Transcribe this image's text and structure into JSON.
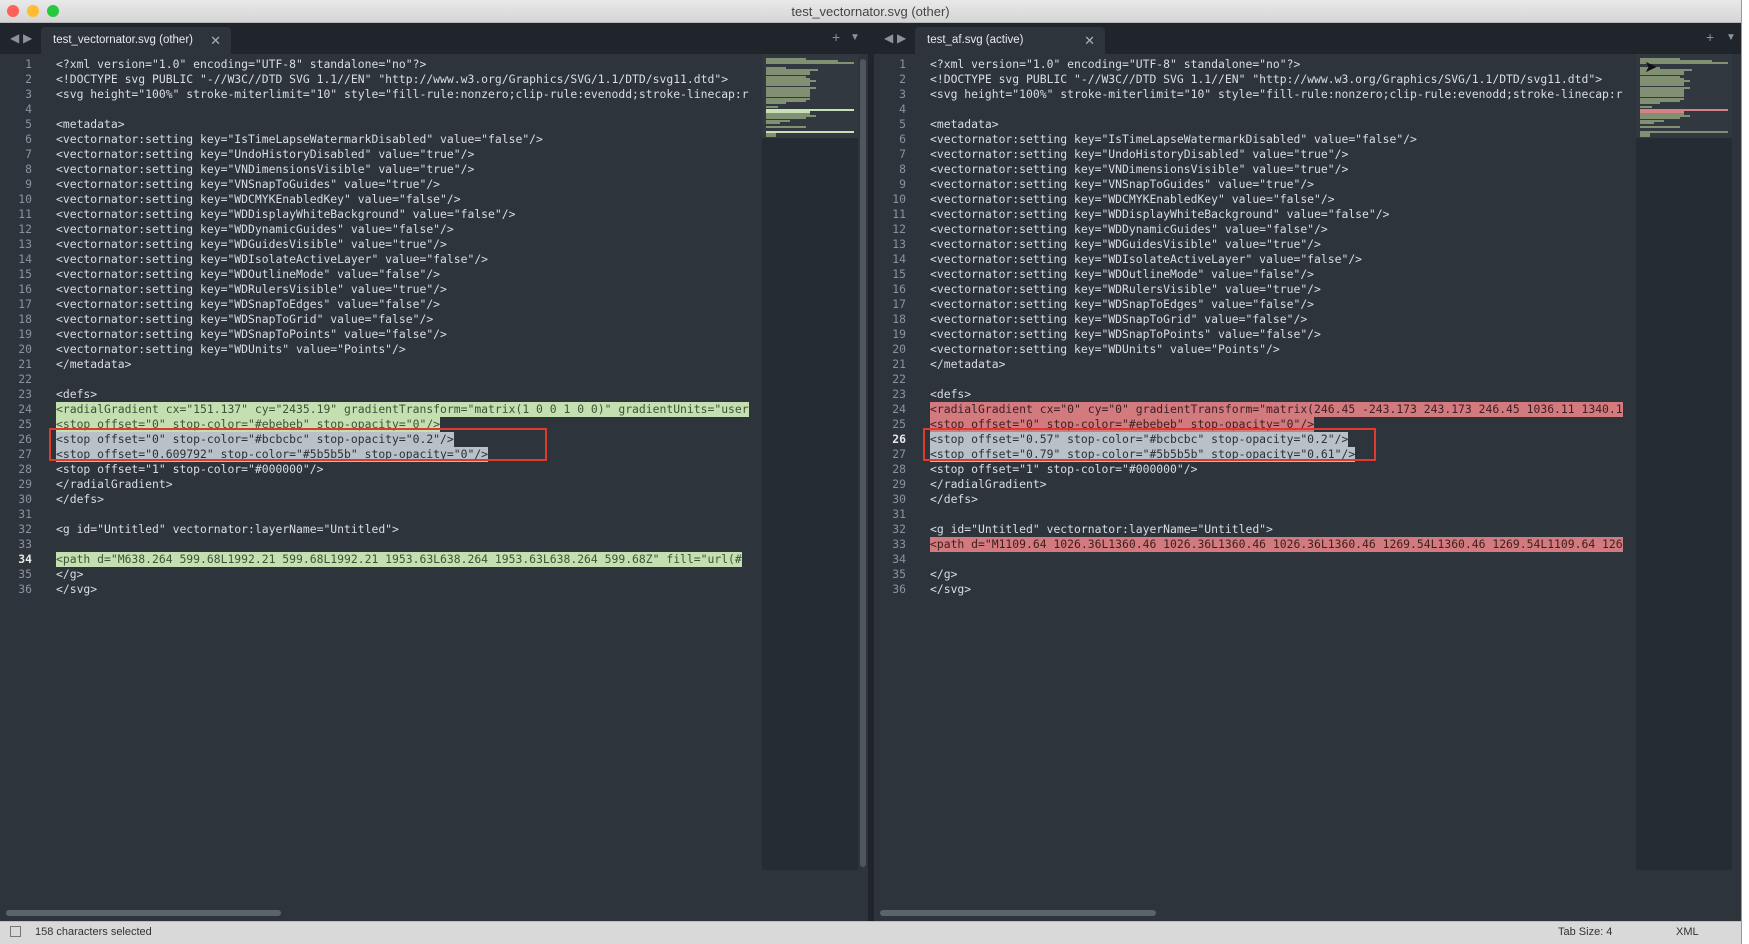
{
  "window": {
    "title": "test_vectornator.svg (other)"
  },
  "left_pane": {
    "tab_label": "test_vectornator.svg (other)",
    "lines": [
      "<?xml version=\"1.0\" encoding=\"UTF-8\" standalone=\"no\"?>",
      "<!DOCTYPE svg PUBLIC \"-//W3C//DTD SVG 1.1//EN\" \"http://www.w3.org/Graphics/SVG/1.1/DTD/svg11.dtd\">",
      "<svg height=\"100%\" stroke-miterlimit=\"10\" style=\"fill-rule:nonzero;clip-rule:evenodd;stroke-linecap:r",
      "",
      "<metadata>",
      "<vectornator:setting key=\"IsTimeLapseWatermarkDisabled\" value=\"false\"/>",
      "<vectornator:setting key=\"UndoHistoryDisabled\" value=\"true\"/>",
      "<vectornator:setting key=\"VNDimensionsVisible\" value=\"true\"/>",
      "<vectornator:setting key=\"VNSnapToGuides\" value=\"true\"/>",
      "<vectornator:setting key=\"WDCMYKEnabledKey\" value=\"false\"/>",
      "<vectornator:setting key=\"WDDisplayWhiteBackground\" value=\"false\"/>",
      "<vectornator:setting key=\"WDDynamicGuides\" value=\"false\"/>",
      "<vectornator:setting key=\"WDGuidesVisible\" value=\"true\"/>",
      "<vectornator:setting key=\"WDIsolateActiveLayer\" value=\"false\"/>",
      "<vectornator:setting key=\"WDOutlineMode\" value=\"false\"/>",
      "<vectornator:setting key=\"WDRulersVisible\" value=\"true\"/>",
      "<vectornator:setting key=\"WDSnapToEdges\" value=\"false\"/>",
      "<vectornator:setting key=\"WDSnapToGrid\" value=\"false\"/>",
      "<vectornator:setting key=\"WDSnapToPoints\" value=\"false\"/>",
      "<vectornator:setting key=\"WDUnits\" value=\"Points\"/>",
      "</metadata>",
      "",
      "<defs>",
      "<radialGradient cx=\"151.137\" cy=\"2435.19\" gradientTransform=\"matrix(1 0 0 1 0 0)\" gradientUnits=\"user",
      "<stop offset=\"0\" stop-color=\"#ebebeb\" stop-opacity=\"0\"/>",
      "<stop offset=\"0\" stop-color=\"#bcbcbc\" stop-opacity=\"0.2\"/>",
      "<stop offset=\"0.609792\" stop-color=\"#5b5b5b\" stop-opacity=\"0\"/>",
      "<stop offset=\"1\" stop-color=\"#000000\"/>",
      "</radialGradient>",
      "</defs>",
      "",
      "<g id=\"Untitled\" vectornator:layerName=\"Untitled\">",
      "",
      "<path d=\"M638.264 599.68L1992.21 599.68L1992.21 1953.63L638.264 1953.63L638.264 599.68Z\" fill=\"url(#",
      "</g>",
      "</svg>"
    ]
  },
  "right_pane": {
    "tab_label": "test_af.svg (active)",
    "lines": [
      "<?xml version=\"1.0\" encoding=\"UTF-8\" standalone=\"no\"?>",
      "<!DOCTYPE svg PUBLIC \"-//W3C//DTD SVG 1.1//EN\" \"http://www.w3.org/Graphics/SVG/1.1/DTD/svg11.dtd\">",
      "<svg height=\"100%\" stroke-miterlimit=\"10\" style=\"fill-rule:nonzero;clip-rule:evenodd;stroke-linecap:r",
      "",
      "<metadata>",
      "<vectornator:setting key=\"IsTimeLapseWatermarkDisabled\" value=\"false\"/>",
      "<vectornator:setting key=\"UndoHistoryDisabled\" value=\"true\"/>",
      "<vectornator:setting key=\"VNDimensionsVisible\" value=\"true\"/>",
      "<vectornator:setting key=\"VNSnapToGuides\" value=\"true\"/>",
      "<vectornator:setting key=\"WDCMYKEnabledKey\" value=\"false\"/>",
      "<vectornator:setting key=\"WDDisplayWhiteBackground\" value=\"false\"/>",
      "<vectornator:setting key=\"WDDynamicGuides\" value=\"false\"/>",
      "<vectornator:setting key=\"WDGuidesVisible\" value=\"true\"/>",
      "<vectornator:setting key=\"WDIsolateActiveLayer\" value=\"false\"/>",
      "<vectornator:setting key=\"WDOutlineMode\" value=\"false\"/>",
      "<vectornator:setting key=\"WDRulersVisible\" value=\"true\"/>",
      "<vectornator:setting key=\"WDSnapToEdges\" value=\"false\"/>",
      "<vectornator:setting key=\"WDSnapToGrid\" value=\"false\"/>",
      "<vectornator:setting key=\"WDSnapToPoints\" value=\"false\"/>",
      "<vectornator:setting key=\"WDUnits\" value=\"Points\"/>",
      "</metadata>",
      "",
      "<defs>",
      "<radialGradient cx=\"0\" cy=\"0\" gradientTransform=\"matrix(246.45 -243.173 243.173 246.45 1036.11 1340.1",
      "<stop offset=\"0\" stop-color=\"#ebebeb\" stop-opacity=\"0\"/>",
      "<stop offset=\"0.57\" stop-color=\"#bcbcbc\" stop-opacity=\"0.2\"/>",
      "<stop offset=\"0.79\" stop-color=\"#5b5b5b\" stop-opacity=\"0.61\"/>",
      "<stop offset=\"1\" stop-color=\"#000000\"/>",
      "</radialGradient>",
      "</defs>",
      "",
      "<g id=\"Untitled\" vectornator:layerName=\"Untitled\">",
      "<path d=\"M1109.64 1026.36L1360.46 1026.36L1360.46 1026.36L1360.46 1269.54L1360.46 1269.54L1109.64 126",
      "",
      "</g>",
      "</svg>"
    ]
  },
  "status": {
    "selection": "158 characters selected",
    "tab_size": "Tab Size: 4",
    "syntax": "XML"
  },
  "colors": {
    "editor_bg": "#2d343c",
    "diff_added": "#c4e0b0",
    "diff_removed": "#d37a7e",
    "annotation_box": "#e03a2e"
  }
}
